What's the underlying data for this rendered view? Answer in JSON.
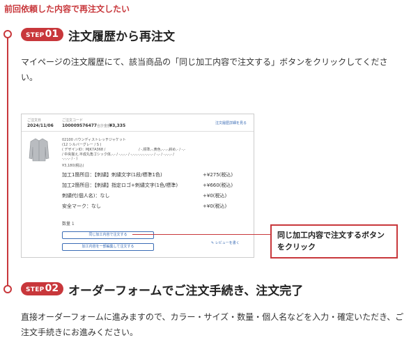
{
  "page_heading": "前回依頼した内容で再注文したい",
  "accent_color": "#c8373b",
  "steps": [
    {
      "step_word": "STEP",
      "step_num": "01",
      "title": "注文履歴から再注文",
      "description": "マイページの注文履歴にて、該当商品の「同じ加工内容で注文する」ボタンをクリックしてください。"
    },
    {
      "step_word": "STEP",
      "step_num": "02",
      "title": "オーダーフォームでご注文手続き、注文完了",
      "description": "直接オーダーフォームに進みますので、カラー・サイズ・数量・個人名などを入力・確定いただき、ご注文手続きにお進みください。"
    }
  ],
  "order_card": {
    "date_label": "ご注文日",
    "date_value": "2024/11/06",
    "code_label": "ご注文コード",
    "code_value": "100009576477",
    "total_label": "合計金額",
    "total_value": "¥3,335",
    "detail_link": "注文履歴詳細を見る",
    "product_name": "02100 バウンディストレッチジャケット",
    "product_color": "(12 シルバーグレー / S )",
    "design_id": "( デザインID：MJK7A368 /",
    "design_options": "/ -,標準,-,黄色,-,-,-,斜め,- / -,-",
    "font_line": "/ 中央揃え,平成丸角ゴシック体,-,- / -,-,-,- / -,-,-,-,-,-,-,-,-,- / -,- / -,-,-,- /",
    "font_line2": "-,-,-,- / - )",
    "base_price": "¥3,180(税込)",
    "process_rows": [
      {
        "label": "加工1箇所目：【刺繍】刺繍文字(1段/標準1色)",
        "price": "+¥275(税込)"
      },
      {
        "label": "加工2箇所目：【刺繍】指定ロゴ+刺繍文字(1色/標準)",
        "price": "+¥660(税込)"
      },
      {
        "label": "刺繍代(個人名)：なし",
        "price": "+¥0(税込)"
      },
      {
        "label": "安全マーク：なし",
        "price": "+¥0(税込)"
      }
    ],
    "quantity": "数量 1",
    "reorder_button": "同じ加工内容で注文する",
    "partial_edit_button": "加工内容を一部編集して注文する",
    "review_link": "✎ レビューを書く"
  },
  "callout": {
    "line1": "同じ加工内容で注文するボタン",
    "line2": "をクリック"
  }
}
